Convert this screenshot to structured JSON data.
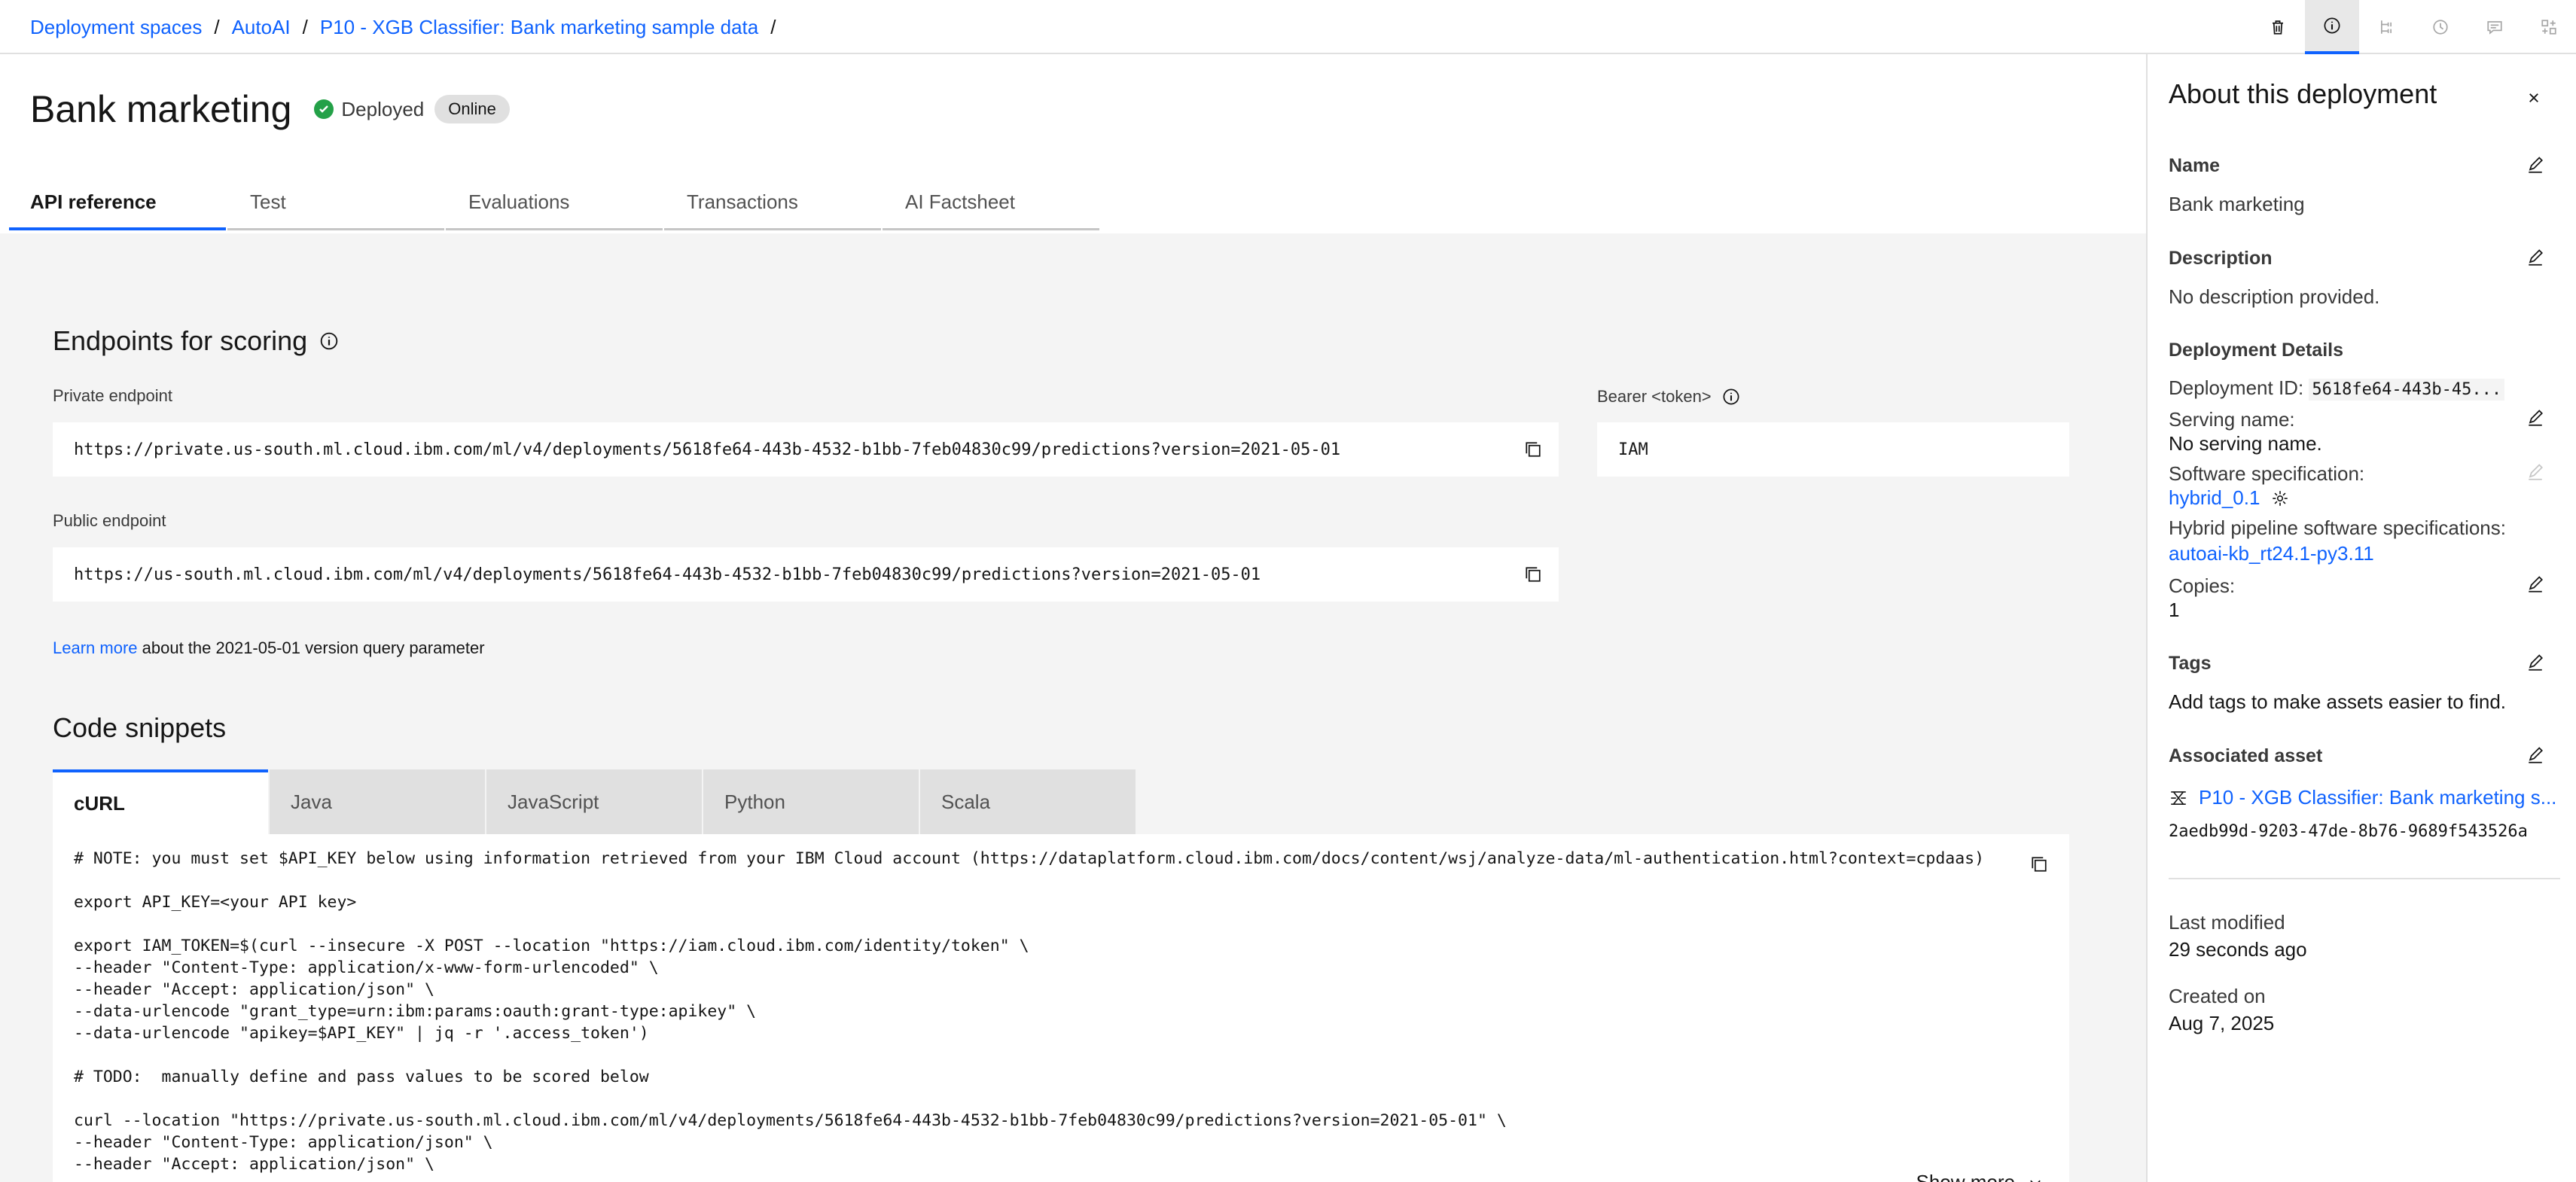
{
  "breadcrumb": {
    "items": [
      "Deployment spaces",
      "AutoAI",
      "P10 - XGB Classifier: Bank marketing sample data"
    ],
    "separator": "/"
  },
  "header_tools": [
    "trash-icon",
    "info-icon",
    "lineage-icon",
    "history-icon",
    "comment-icon",
    "compare-icon"
  ],
  "page": {
    "title": "Bank marketing",
    "status": "Deployed",
    "badge": "Online"
  },
  "tabs": [
    "API reference",
    "Test",
    "Evaluations",
    "Transactions",
    "AI Factsheet"
  ],
  "endpoints": {
    "title": "Endpoints for scoring",
    "private_label": "Private endpoint",
    "private_url": "https://private.us-south.ml.cloud.ibm.com/ml/v4/deployments/5618fe64-443b-4532-b1bb-7feb04830c99/predictions?version=2021-05-01",
    "public_label": "Public endpoint",
    "public_url": "https://us-south.ml.cloud.ibm.com/ml/v4/deployments/5618fe64-443b-4532-b1bb-7feb04830c99/predictions?version=2021-05-01",
    "bearer_label": "Bearer <token>",
    "bearer_value": "IAM",
    "learn_more_link": "Learn more",
    "learn_more_text": " about the 2021-05-01 version query parameter"
  },
  "code": {
    "title": "Code snippets",
    "tabs": [
      "cURL",
      "Java",
      "JavaScript",
      "Python",
      "Scala"
    ],
    "snippet": "# NOTE: you must set $API_KEY below using information retrieved from your IBM Cloud account (https://dataplatform.cloud.ibm.com/docs/content/wsj/analyze-data/ml-authentication.html?context=cpdaas)\n\nexport API_KEY=<your API key>\n\nexport IAM_TOKEN=$(curl --insecure -X POST --location \"https://iam.cloud.ibm.com/identity/token\" \\\n--header \"Content-Type: application/x-www-form-urlencoded\" \\\n--header \"Accept: application/json\" \\\n--data-urlencode \"grant_type=urn:ibm:params:oauth:grant-type:apikey\" \\\n--data-urlencode \"apikey=$API_KEY\" | jq -r '.access_token')\n\n# TODO:  manually define and pass values to be scored below\n\ncurl --location \"https://private.us-south.ml.cloud.ibm.com/ml/v4/deployments/5618fe64-443b-4532-b1bb-7feb04830c99/predictions?version=2021-05-01\" \\\n--header \"Content-Type: application/json\" \\\n--header \"Accept: application/json\" \\",
    "show_more": "Show more"
  },
  "panel": {
    "title": "About this deployment",
    "name_label": "Name",
    "name_value": "Bank marketing",
    "description_label": "Description",
    "description_value": "No description provided.",
    "details_label": "Deployment Details",
    "deployment_id_label": "Deployment ID: ",
    "deployment_id_value": "5618fe64-443b-45...",
    "serving_name_label": "Serving name:",
    "serving_name_value": "No serving name.",
    "software_spec_label": "Software specification:",
    "software_spec_value": "hybrid_0.1",
    "hybrid_label": "Hybrid pipeline software specifications:",
    "hybrid_value": "autoai-kb_rt24.1-py3.11",
    "copies_label": "Copies:",
    "copies_value": "1",
    "tags_label": "Tags",
    "tags_value": "Add tags to make assets easier to find.",
    "asset_label": "Associated asset",
    "asset_name": "P10 - XGB Classifier: Bank marketing s...",
    "asset_id": "2aedb99d-9203-47de-8b76-9689f543526a",
    "modified_label": "Last modified",
    "modified_value": "29 seconds ago",
    "created_label": "Created on",
    "created_value": "Aug 7, 2025"
  }
}
